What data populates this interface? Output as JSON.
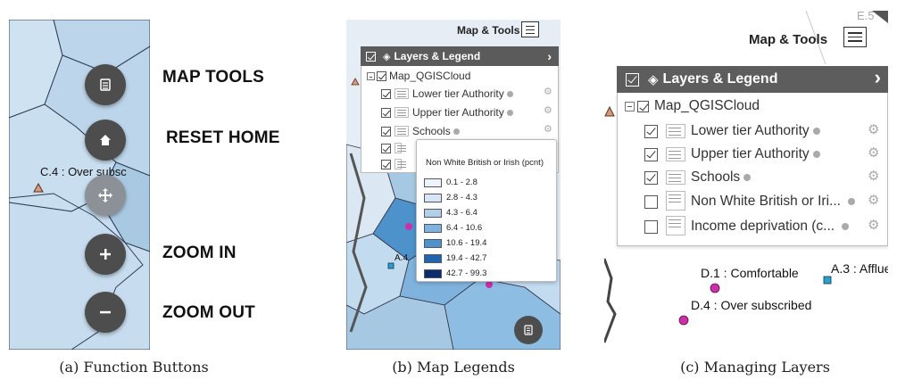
{
  "panel_a": {
    "buttons": [
      {
        "label": "MAP TOOLS",
        "icon": "list-icon"
      },
      {
        "label": "RESET HOME",
        "icon": "home-icon"
      },
      {
        "label": "",
        "icon": "move-arrows-icon"
      },
      {
        "label": "ZOOM IN",
        "icon": "plus-icon"
      },
      {
        "label": "ZOOM OUT",
        "icon": "minus-icon"
      }
    ],
    "map_label": "C.4 : Over subsc",
    "caption": "(a) Function Buttons"
  },
  "panel_b": {
    "map_tools_label": "Map & Tools",
    "layers_title": "Layers & Legend",
    "root_layer": "Map_QGISCloud",
    "layers": [
      {
        "name": "Lower tier Authority",
        "checked": true
      },
      {
        "name": "Upper tier Authority",
        "checked": true
      },
      {
        "name": "Schools",
        "checked": true
      },
      {
        "name": "",
        "checked": true
      },
      {
        "name": "",
        "checked": true
      }
    ],
    "legend": {
      "title": "Non White British or Irish (pcnt)",
      "items": [
        {
          "label": "0.1 - 2.8",
          "color": "#eef4fb"
        },
        {
          "label": "2.8 - 4.3",
          "color": "#d7e6f4"
        },
        {
          "label": "4.3 - 6.4",
          "color": "#b2cfe8"
        },
        {
          "label": "6.4 - 10.6",
          "color": "#7fb2dc"
        },
        {
          "label": "10.6 - 19.4",
          "color": "#4d92cb"
        },
        {
          "label": "19.4 - 42.7",
          "color": "#2166ac"
        },
        {
          "label": "42.7 - 99.3",
          "color": "#0a2c6e"
        }
      ]
    },
    "map_label": "A.4",
    "caption": "(b) Map Legends"
  },
  "panel_c": {
    "map_tools_label": "Map & Tools",
    "corner_label": "E.5",
    "layers_title": "Layers & Legend",
    "root_layer": "Map_QGISCloud",
    "layers": [
      {
        "name": "Lower tier Authority",
        "checked": true
      },
      {
        "name": "Upper tier Authority",
        "checked": true
      },
      {
        "name": "Schools",
        "checked": true
      },
      {
        "name": "Non White British or Iri...",
        "checked": false
      },
      {
        "name": "Income deprivation (c...",
        "checked": false
      }
    ],
    "map_labels": {
      "d1": "D.1 : Comfortable",
      "a3": "A.3 : Afflue",
      "d4": "D.4 : Over subscribed"
    },
    "caption": "(c) Managing Layers"
  },
  "colors": {
    "fab": "#4d4d4d",
    "header": "#5b5b5b",
    "school_marker": "#cc2fa8",
    "school_marker_b": "#2b9fd1"
  }
}
